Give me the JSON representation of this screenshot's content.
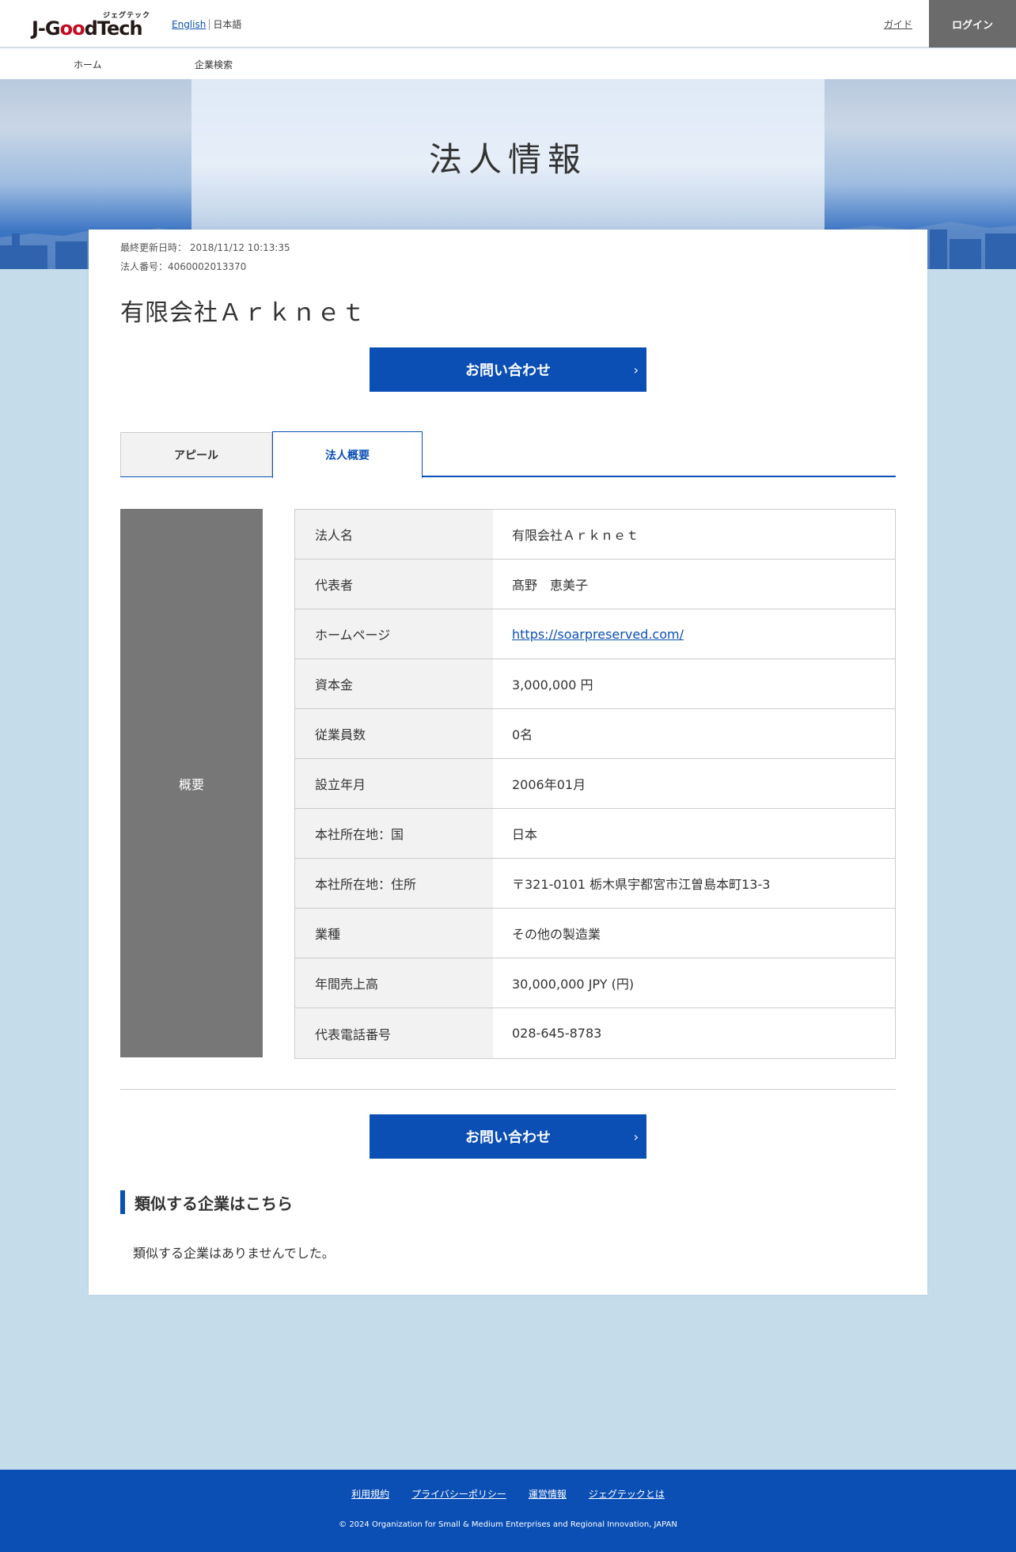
{
  "header": {
    "logo_ruby": "ジェグテック",
    "logo_text_1": "J-G",
    "logo_text_oo": "oo",
    "logo_text_2": "dTech",
    "lang_english": "English",
    "lang_japanese": "日本語",
    "guide": "ガイド",
    "login": "ログイン"
  },
  "nav": {
    "items": [
      "ホーム",
      "企業検索"
    ]
  },
  "hero": {
    "title": "法人情報"
  },
  "meta": {
    "updated": "最終更新日時： 2018/11/12 10:13:35",
    "corp_number": "法人番号：4060002013370"
  },
  "company": {
    "name": "有限会社Ａｒｋｎｅｔ"
  },
  "cta": {
    "label": "お問い合わせ",
    "chevron": "›"
  },
  "tabs": [
    {
      "label": "アピール",
      "active": false
    },
    {
      "label": "法人概要",
      "active": true
    }
  ],
  "overview": {
    "side_label": "概要",
    "rows": [
      {
        "key": "法人名",
        "value": "有限会社Ａｒｋｎｅｔ"
      },
      {
        "key": "代表者",
        "value": "髙野　恵美子"
      },
      {
        "key": "ホームページ",
        "value": "https://soarpreserved.com/"
      },
      {
        "key": "資本金",
        "value": "3,000,000 円"
      },
      {
        "key": "従業員数",
        "value": "0名"
      },
      {
        "key": "設立年月",
        "value": "2006年01月"
      },
      {
        "key": "本社所在地：国",
        "value": "日本"
      },
      {
        "key": "本社所在地：住所",
        "value": "〒321-0101 栃木県宇都宮市江曽島本町13-3"
      },
      {
        "key": "業種",
        "value": "その他の製造業"
      },
      {
        "key": "年間売上高",
        "value": "30,000,000 JPY (円)"
      },
      {
        "key": "代表電話番号",
        "value": "028-645-8783"
      }
    ]
  },
  "similar": {
    "heading": "類似する企業はこちら",
    "empty_text": "類似する企業はありませんでした。"
  },
  "footer": {
    "links": [
      "利用規約",
      "プライバシーポリシー",
      "運営情報",
      "ジェグテックとは"
    ],
    "copyright": "© 2024 Organization for Small & Medium Enterprises and Regional Innovation, JAPAN"
  },
  "colors": {
    "brand_blue": "#0b4fb5",
    "logo_red": "#c30d23",
    "page_bg": "#c5dceb",
    "login_bg": "#6b6b6b"
  }
}
